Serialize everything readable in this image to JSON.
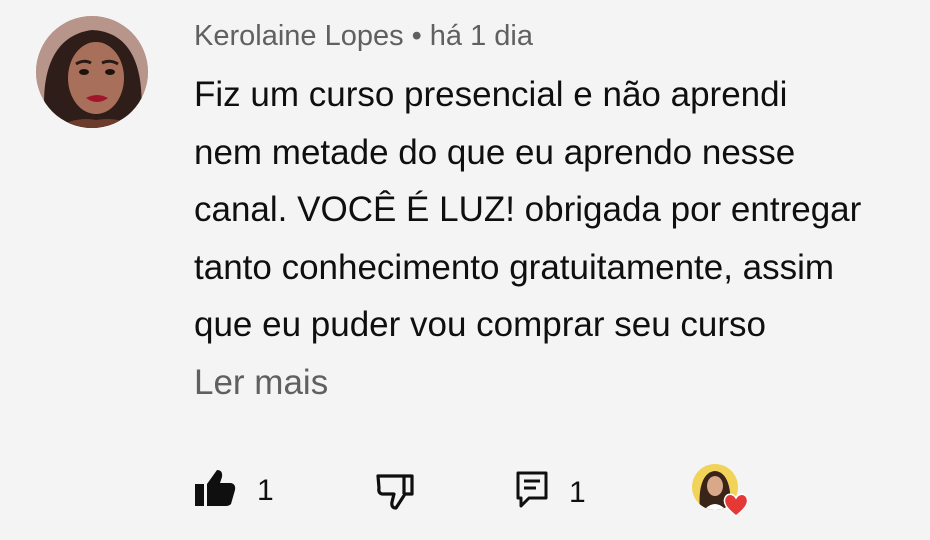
{
  "comment": {
    "author": "Kerolaine Lopes",
    "separator": "•",
    "time": "há 1 dia",
    "text": "Fiz um curso presencial e não aprendi\nnem metade do que eu aprendo nesse\ncanal. VOCÊ É LUZ! obrigada por entregar\ntanto conhecimento gratuitamente, assim\nque eu puder vou comprar seu curso",
    "read_more": "Ler mais"
  },
  "actions": {
    "like_count": "1",
    "reply_count": "1"
  },
  "icons": {
    "like": "thumbs-up-icon",
    "dislike": "thumbs-down-icon",
    "reply": "comment-reply-icon",
    "heart": "heart-icon"
  },
  "colors": {
    "background": "#f4f4f4",
    "text": "#0f0f0f",
    "secondary": "#606060",
    "heart": "#e53935"
  }
}
